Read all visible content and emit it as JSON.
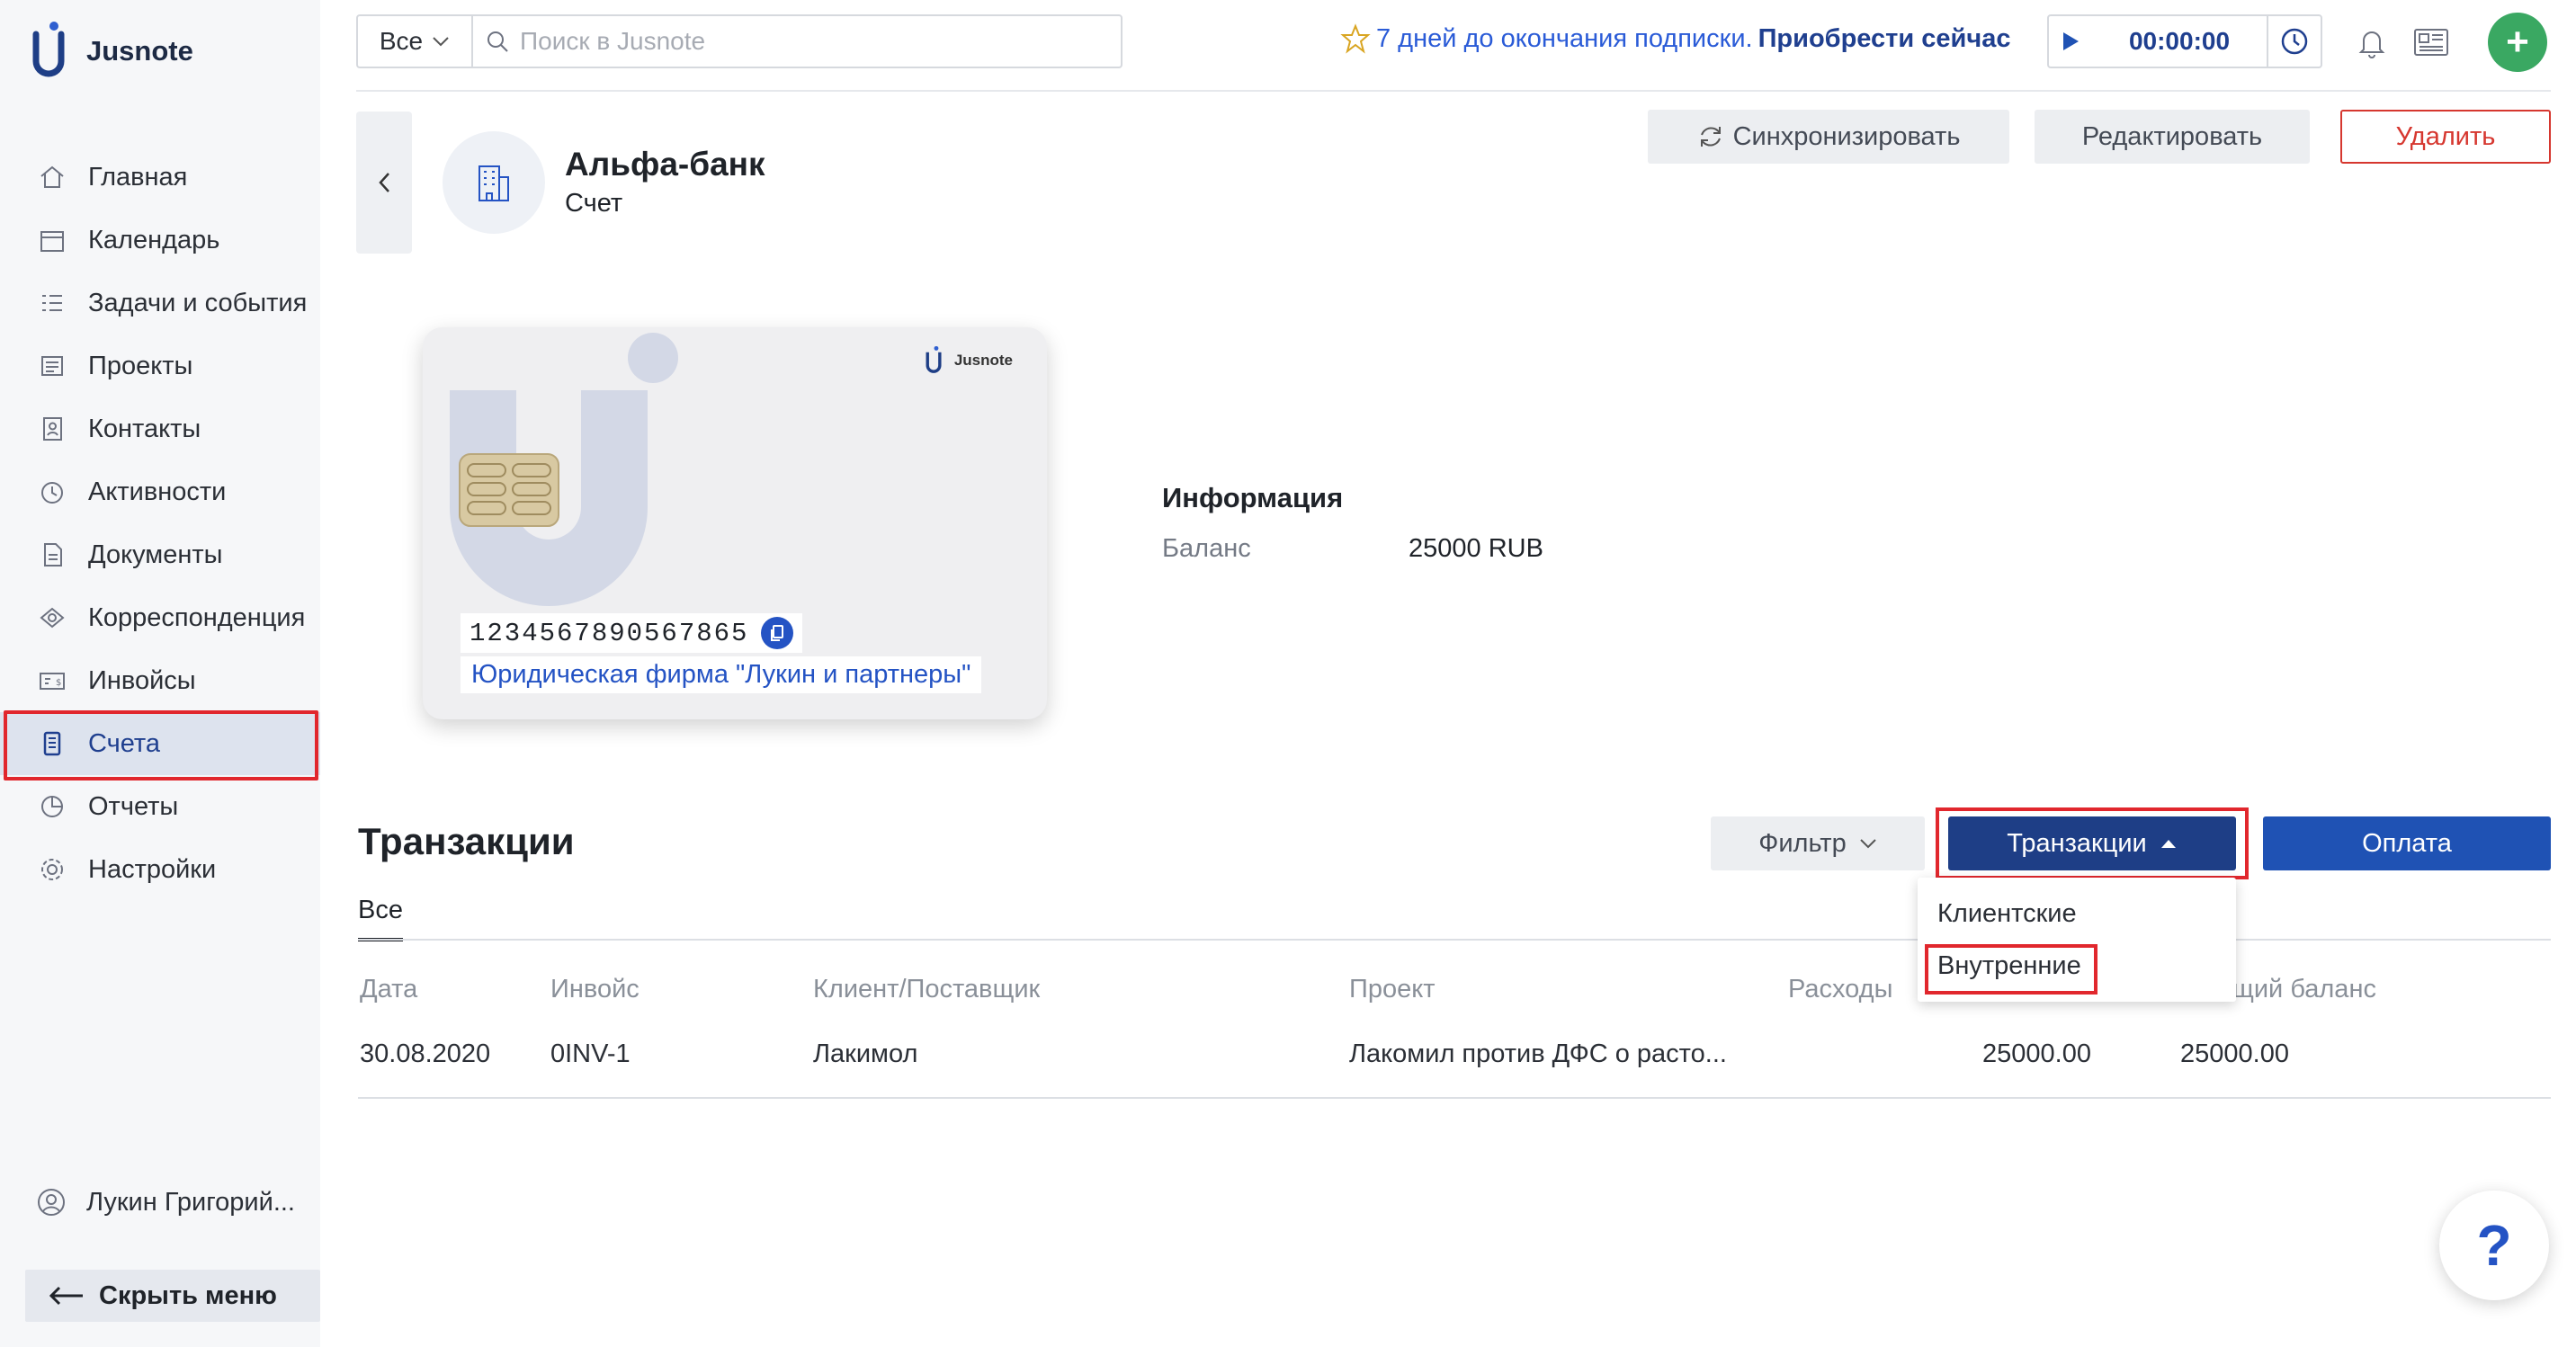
{
  "app": {
    "name": "Jusnote"
  },
  "sidebar": {
    "items": [
      {
        "label": "Главная",
        "icon": "home-icon"
      },
      {
        "label": "Календарь",
        "icon": "calendar-icon"
      },
      {
        "label": "Задачи и события",
        "icon": "tasks-icon"
      },
      {
        "label": "Проекты",
        "icon": "projects-icon"
      },
      {
        "label": "Контакты",
        "icon": "contacts-icon"
      },
      {
        "label": "Активности",
        "icon": "activity-icon"
      },
      {
        "label": "Документы",
        "icon": "documents-icon"
      },
      {
        "label": "Корреспонденция",
        "icon": "correspondence-icon"
      },
      {
        "label": "Инвойсы",
        "icon": "invoices-icon"
      },
      {
        "label": "Счета",
        "icon": "accounts-icon",
        "active": true
      },
      {
        "label": "Отчеты",
        "icon": "reports-icon"
      },
      {
        "label": "Настройки",
        "icon": "settings-icon"
      }
    ],
    "user": "Лукин Григорий...",
    "hide_menu": "Скрыть меню"
  },
  "topbar": {
    "scope": "Все",
    "search_placeholder": "Поиск в Jusnote",
    "subscription_text": "7 дней до окончания подписки.",
    "subscription_link": "Приобрести сейчас",
    "timer": "00:00:00"
  },
  "header": {
    "title": "Альфа-банк",
    "subtitle": "Счет",
    "sync_label": "Синхронизировать",
    "edit_label": "Редактировать",
    "delete_label": "Удалить"
  },
  "card": {
    "brand": "Jusnote",
    "number": "1234567890567865",
    "organization": "Юридическая фирма \"Лукин и партнеры\""
  },
  "info": {
    "title": "Информация",
    "balance_label": "Баланс",
    "balance_value": "25000 RUB"
  },
  "transactions": {
    "title": "Транзакции",
    "filter_label": "Фильтр",
    "tx_button_label": "Транзакции",
    "pay_label": "Оплата",
    "tab_all": "Все",
    "dropdown": [
      "Клиентские",
      "Внутренние"
    ],
    "columns": [
      "Дата",
      "Инвойс",
      "Клиент/Поставщик",
      "Проект",
      "Расходы",
      "щий баланс"
    ],
    "rows": [
      {
        "date": "30.08.2020",
        "invoice": "0INV-1",
        "client": "Лакимол",
        "project": "Лакомил против ДФС о расто...",
        "amount": "25000.00",
        "balance": "25000.00"
      }
    ]
  },
  "colors": {
    "accent": "#1e3e86",
    "highlight": "#e1272d",
    "link": "#2453c4",
    "add": "#3aa862"
  }
}
